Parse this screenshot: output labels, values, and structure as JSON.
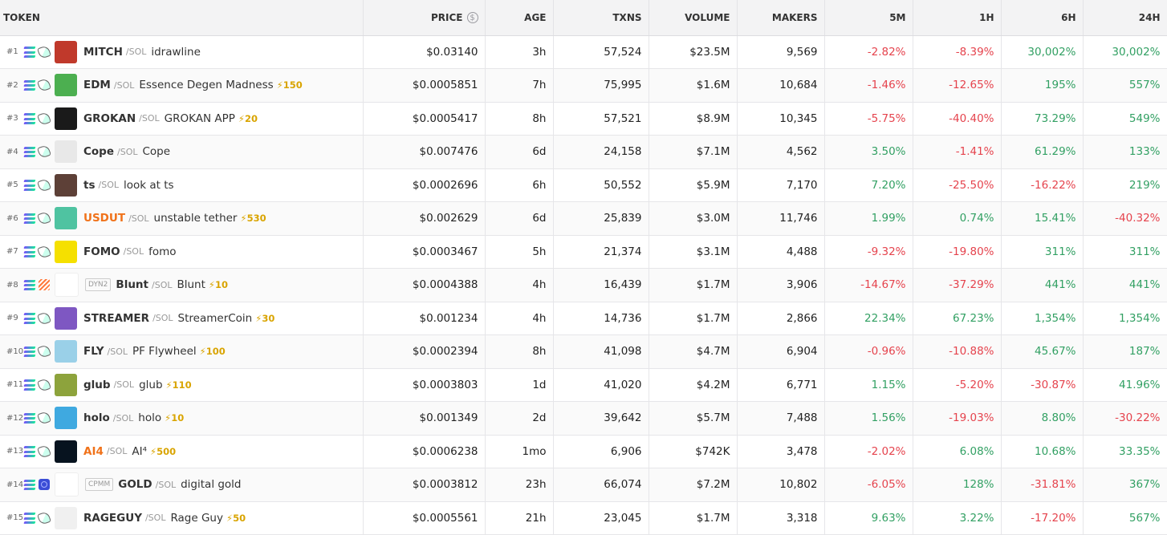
{
  "columns": {
    "token": "TOKEN",
    "price": "PRICE",
    "price_icon": "$",
    "age": "AGE",
    "txns": "TXNS",
    "volume": "VOLUME",
    "makers": "MAKERS",
    "m5": "5M",
    "h1": "1H",
    "h6": "6H",
    "h24": "24H"
  },
  "pair_suffix": "/SOL",
  "colors": {
    "negative": "#e5434d",
    "positive": "#32a063",
    "boost": "#d9a400",
    "highlight_symbol": "#f0721a"
  },
  "rows": [
    {
      "rank": "#1",
      "dex": "pump-icon",
      "tag": "",
      "symbol": "MITCH",
      "highlight": false,
      "name": "idrawline",
      "boost": "",
      "price": "$0.03140",
      "age": "3h",
      "txns": "57,524",
      "volume": "$23.5M",
      "makers": "9,569",
      "m5": "-2.82%",
      "h1": "-8.39%",
      "h6": "30,002%",
      "h24": "30,002%",
      "avatar": "#c0392b"
    },
    {
      "rank": "#2",
      "dex": "pump-icon",
      "tag": "",
      "symbol": "EDM",
      "highlight": false,
      "name": "Essence Degen Madness",
      "boost": "150",
      "price": "$0.0005851",
      "age": "7h",
      "txns": "75,995",
      "volume": "$1.6M",
      "makers": "10,684",
      "m5": "-1.46%",
      "h1": "-12.65%",
      "h6": "195%",
      "h24": "557%",
      "avatar": "#4caf50"
    },
    {
      "rank": "#3",
      "dex": "pump-icon",
      "tag": "",
      "symbol": "GROKAN",
      "highlight": false,
      "name": "GROKAN APP",
      "boost": "20",
      "price": "$0.0005417",
      "age": "8h",
      "txns": "57,521",
      "volume": "$8.9M",
      "makers": "10,345",
      "m5": "-5.75%",
      "h1": "-40.40%",
      "h6": "73.29%",
      "h24": "549%",
      "avatar": "#1a1a1a"
    },
    {
      "rank": "#4",
      "dex": "pump-icon",
      "tag": "",
      "symbol": "Cope",
      "highlight": false,
      "name": "Cope",
      "boost": "",
      "price": "$0.007476",
      "age": "6d",
      "txns": "24,158",
      "volume": "$7.1M",
      "makers": "4,562",
      "m5": "3.50%",
      "h1": "-1.41%",
      "h6": "61.29%",
      "h24": "133%",
      "avatar": "#e8e8e8"
    },
    {
      "rank": "#5",
      "dex": "pump-icon",
      "tag": "",
      "symbol": "ts",
      "highlight": false,
      "name": "look at ts",
      "boost": "",
      "price": "$0.0002696",
      "age": "6h",
      "txns": "50,552",
      "volume": "$5.9M",
      "makers": "7,170",
      "m5": "7.20%",
      "h1": "-25.50%",
      "h6": "-16.22%",
      "h24": "219%",
      "avatar": "#5d4037"
    },
    {
      "rank": "#6",
      "dex": "pump-icon",
      "tag": "",
      "symbol": "USDUT",
      "highlight": true,
      "name": "unstable tether",
      "boost": "530",
      "price": "$0.002629",
      "age": "6d",
      "txns": "25,839",
      "volume": "$3.0M",
      "makers": "11,746",
      "m5": "1.99%",
      "h1": "0.74%",
      "h6": "15.41%",
      "h24": "-40.32%",
      "avatar": "#4fc3a1"
    },
    {
      "rank": "#7",
      "dex": "pump-icon",
      "tag": "",
      "symbol": "FOMO",
      "highlight": false,
      "name": "fomo",
      "boost": "",
      "price": "$0.0003467",
      "age": "5h",
      "txns": "21,374",
      "volume": "$3.1M",
      "makers": "4,488",
      "m5": "-9.32%",
      "h1": "-19.80%",
      "h6": "311%",
      "h24": "311%",
      "avatar": "#f5e000"
    },
    {
      "rank": "#8",
      "dex": "meteora-icon",
      "tag": "DYN2",
      "symbol": "Blunt",
      "highlight": false,
      "name": "Blunt",
      "boost": "10",
      "price": "$0.0004388",
      "age": "4h",
      "txns": "16,439",
      "volume": "$1.7M",
      "makers": "3,906",
      "m5": "-14.67%",
      "h1": "-37.29%",
      "h6": "441%",
      "h24": "441%",
      "avatar": "#ffffff"
    },
    {
      "rank": "#9",
      "dex": "pump-icon",
      "tag": "",
      "symbol": "STREAMER",
      "highlight": false,
      "name": "StreamerCoin",
      "boost": "30",
      "price": "$0.001234",
      "age": "4h",
      "txns": "14,736",
      "volume": "$1.7M",
      "makers": "2,866",
      "m5": "22.34%",
      "h1": "67.23%",
      "h6": "1,354%",
      "h24": "1,354%",
      "avatar": "#7e57c2"
    },
    {
      "rank": "#10",
      "dex": "pump-icon",
      "tag": "",
      "symbol": "FLY",
      "highlight": false,
      "name": "PF Flywheel",
      "boost": "100",
      "price": "$0.0002394",
      "age": "8h",
      "txns": "41,098",
      "volume": "$4.7M",
      "makers": "6,904",
      "m5": "-0.96%",
      "h1": "-10.88%",
      "h6": "45.67%",
      "h24": "187%",
      "avatar": "#9ad0e8"
    },
    {
      "rank": "#11",
      "dex": "pump-icon",
      "tag": "",
      "symbol": "glub",
      "highlight": false,
      "name": "glub",
      "boost": "110",
      "price": "$0.0003803",
      "age": "1d",
      "txns": "41,020",
      "volume": "$4.2M",
      "makers": "6,771",
      "m5": "1.15%",
      "h1": "-5.20%",
      "h6": "-30.87%",
      "h24": "41.96%",
      "avatar": "#8da33c"
    },
    {
      "rank": "#12",
      "dex": "pump-icon",
      "tag": "",
      "symbol": "holo",
      "highlight": false,
      "name": "holo",
      "boost": "10",
      "price": "$0.001349",
      "age": "2d",
      "txns": "39,642",
      "volume": "$5.7M",
      "makers": "7,488",
      "m5": "1.56%",
      "h1": "-19.03%",
      "h6": "8.80%",
      "h24": "-30.22%",
      "avatar": "#3fa9e0"
    },
    {
      "rank": "#13",
      "dex": "pump-icon",
      "tag": "",
      "symbol": "AI4",
      "highlight": true,
      "name": "AI⁴",
      "boost": "500",
      "price": "$0.0006238",
      "age": "1mo",
      "txns": "6,906",
      "volume": "$742K",
      "makers": "3,478",
      "m5": "-2.02%",
      "h1": "6.08%",
      "h6": "10.68%",
      "h24": "33.35%",
      "avatar": "#07131f"
    },
    {
      "rank": "#14",
      "dex": "raydium-icon",
      "tag": "CPMM",
      "symbol": "GOLD",
      "highlight": false,
      "name": "digital gold",
      "boost": "",
      "price": "$0.0003812",
      "age": "23h",
      "txns": "66,074",
      "volume": "$7.2M",
      "makers": "10,802",
      "m5": "-6.05%",
      "h1": "128%",
      "h6": "-31.81%",
      "h24": "367%",
      "avatar": "#ffffff"
    },
    {
      "rank": "#15",
      "dex": "pump-icon",
      "tag": "",
      "symbol": "RAGEGUY",
      "highlight": false,
      "name": "Rage Guy",
      "boost": "50",
      "price": "$0.0005561",
      "age": "21h",
      "txns": "23,045",
      "volume": "$1.7M",
      "makers": "3,318",
      "m5": "9.63%",
      "h1": "3.22%",
      "h6": "-17.20%",
      "h24": "567%",
      "avatar": "#f0f0f0"
    }
  ]
}
